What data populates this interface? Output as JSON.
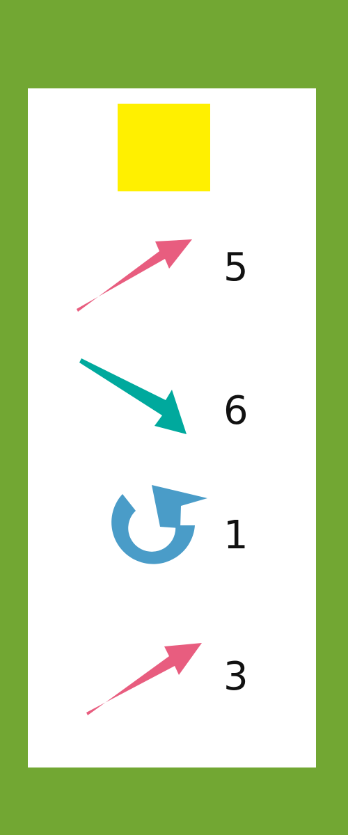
{
  "colors": {
    "background": "#72A733",
    "panel": "#FFFFFF",
    "start_square": "#FFF000",
    "arrow_pink": "#E85D7F",
    "arrow_teal": "#00A99D",
    "arrow_blue": "#4A9CC8"
  },
  "start_marker": {
    "icon": "yellow-square-icon"
  },
  "steps": [
    {
      "icon": "arrow-up-right-icon",
      "count": "5"
    },
    {
      "icon": "arrow-down-right-icon",
      "count": "6"
    },
    {
      "icon": "rotate-clockwise-icon",
      "count": "1"
    },
    {
      "icon": "arrow-up-right-icon",
      "count": "3"
    }
  ]
}
